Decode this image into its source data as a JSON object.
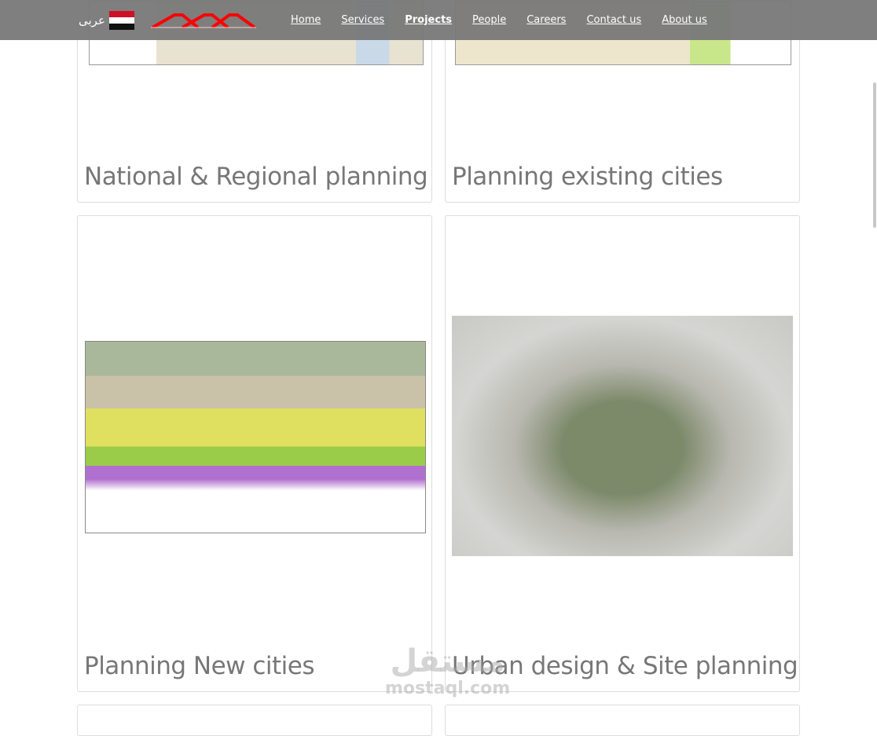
{
  "header": {
    "language_label": "عربى",
    "nav": [
      {
        "label": "Home",
        "active": false
      },
      {
        "label": "Services",
        "active": false
      },
      {
        "label": "Projects",
        "active": true
      },
      {
        "label": "People",
        "active": false
      },
      {
        "label": "Careers",
        "active": false
      },
      {
        "label": "Contact us",
        "active": false
      },
      {
        "label": "About us",
        "active": false
      }
    ]
  },
  "cards": [
    {
      "title": "National & Regional planning"
    },
    {
      "title": "Planning existing cities"
    },
    {
      "title": "Planning New cities"
    },
    {
      "title": "Urban design & Site planning"
    }
  ],
  "watermark": {
    "arabic": "مستقل",
    "latin": "mostaql.com"
  }
}
